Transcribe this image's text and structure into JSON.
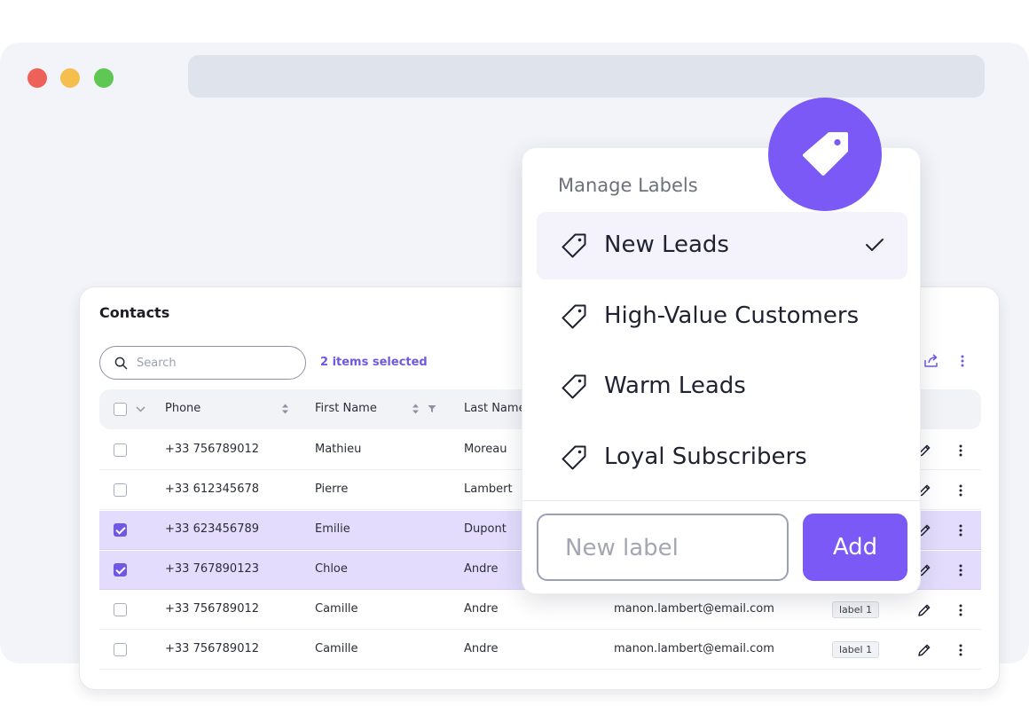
{
  "contacts": {
    "title": "Contacts",
    "search_placeholder": "Search",
    "selected_text": "2 items selected",
    "columns": {
      "phone": "Phone",
      "first_name": "First Name",
      "last_name": "Last Name"
    },
    "rows": [
      {
        "phone": "+33 756789012",
        "first_name": "Mathieu",
        "last_name": "Moreau",
        "email": "",
        "label": "",
        "selected": false
      },
      {
        "phone": "+33 612345678",
        "first_name": "Pierre",
        "last_name": "Lambert",
        "email": "",
        "label": "",
        "selected": false
      },
      {
        "phone": "+33 623456789",
        "first_name": "Emilie",
        "last_name": "Dupont",
        "email": "",
        "label": "",
        "selected": true
      },
      {
        "phone": "+33 767890123",
        "first_name": "Chloe",
        "last_name": "Andre",
        "email": "",
        "label": "",
        "selected": true
      },
      {
        "phone": "+33 756789012",
        "first_name": "Camille",
        "last_name": "Andre",
        "email": "manon.lambert@email.com",
        "label": "label 1",
        "selected": false
      },
      {
        "phone": "+33 756789012",
        "first_name": "Camille",
        "last_name": "Andre",
        "email": "manon.lambert@email.com",
        "label": "label 1",
        "selected": false
      }
    ]
  },
  "manage_labels": {
    "title": "Manage Labels",
    "items": [
      {
        "name": "New Leads",
        "checked": true
      },
      {
        "name": "High-Value Customers",
        "checked": false
      },
      {
        "name": "Warm Leads",
        "checked": false
      },
      {
        "name": "Loyal Subscribers",
        "checked": false
      }
    ],
    "new_label_placeholder": "New label",
    "add_label": "Add"
  },
  "colors": {
    "accent": "#7A59F6",
    "selected_row": "#E3DCFC",
    "window_bg": "#F2F4F9"
  }
}
